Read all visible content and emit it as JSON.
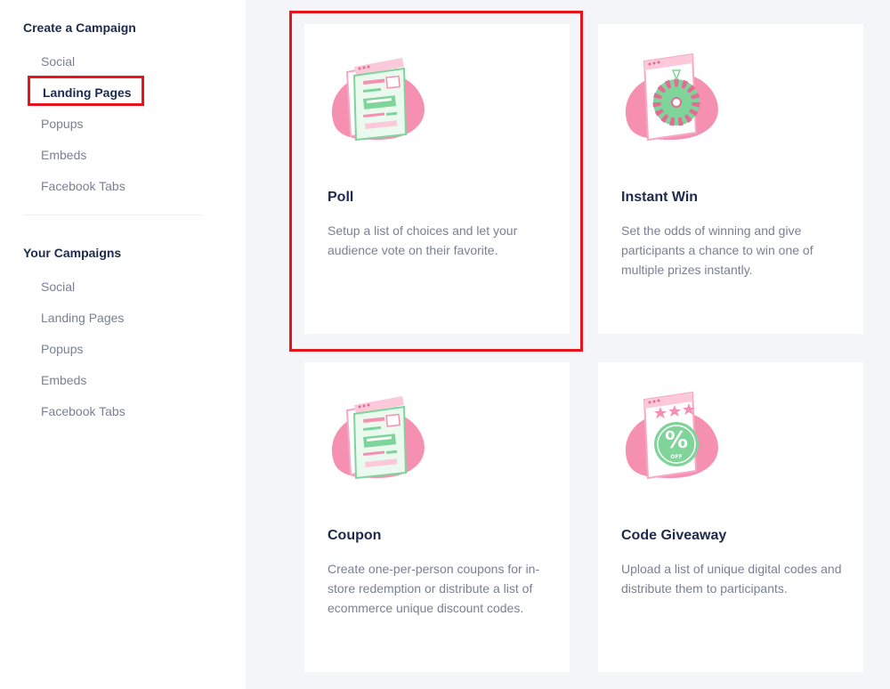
{
  "sidebar": {
    "create_title": "Create a Campaign",
    "create_items": [
      "Social",
      "Landing Pages",
      "Popups",
      "Embeds",
      "Facebook Tabs"
    ],
    "your_title": "Your Campaigns",
    "your_items": [
      "Social",
      "Landing Pages",
      "Popups",
      "Embeds",
      "Facebook Tabs"
    ]
  },
  "cards": [
    {
      "title": "Poll",
      "description": "Setup a list of choices and let your audience vote on their favorite.",
      "icon": "poll-illustration"
    },
    {
      "title": "Instant Win",
      "description": "Set the odds of winning and give participants a chance to win one of multiple prizes instantly.",
      "icon": "prize-wheel-illustration"
    },
    {
      "title": "Coupon",
      "description": "Create one-per-person coupons for in-store redemption or distribute a list of ecommerce unique discount codes.",
      "icon": "coupon-illustration"
    },
    {
      "title": "Code Giveaway",
      "description": "Upload a list of unique digital codes and distribute them to participants.",
      "icon": "discount-badge-illustration"
    }
  ],
  "illustration_text": {
    "percent": "%",
    "off": "OFF"
  },
  "colors": {
    "accent_pink": "#f590b0",
    "accent_green": "#7fd49a",
    "heading": "#1d2a4d",
    "muted": "#7a8093",
    "highlight": "#e8141b"
  }
}
